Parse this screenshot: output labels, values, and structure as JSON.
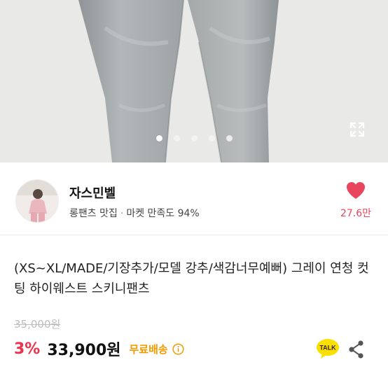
{
  "gallery": {
    "image_alt": "gray denim skinny pants",
    "slide_count": 5,
    "active_slide": 1
  },
  "shop": {
    "name": "자스민벨",
    "category": "롱팬츠 맛집",
    "separator": "·",
    "rating_label": "마켓 만족도 94%",
    "likes": "27.6만"
  },
  "product": {
    "title": "(XS~XL/MADE/기장추가/모델 강추/색감너무예뻐) 그레이 연청 컷팅 하이웨스트 스키니팬츠",
    "original_price": "35,000원",
    "discount": "3%",
    "price": "33,900원",
    "shipping_badge": "무료배송"
  },
  "actions": {
    "talk_label": "TALK"
  },
  "colors": {
    "accent_red": "#f0314b",
    "heart_pink": "#e8455e",
    "shipping_orange": "#f29a00",
    "talk_yellow": "#f9e000"
  }
}
